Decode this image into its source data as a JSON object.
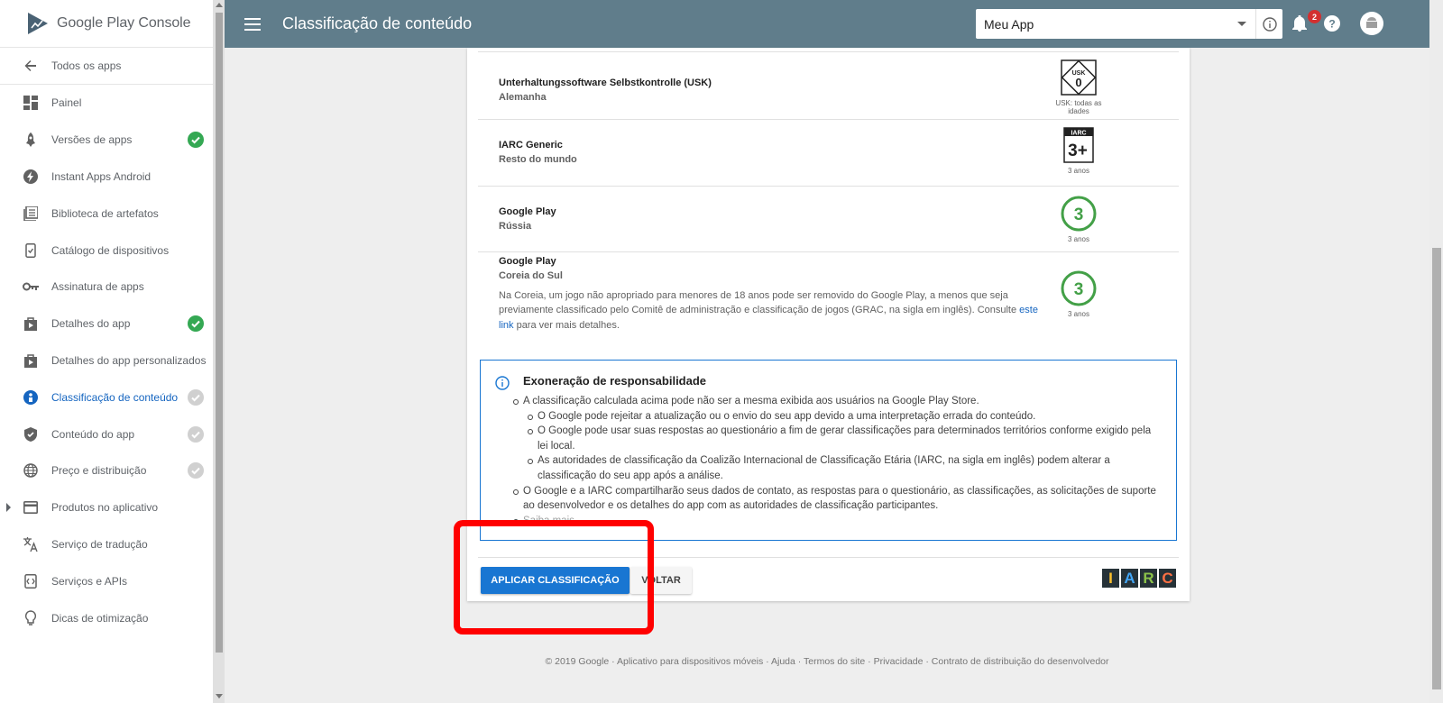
{
  "brand": {
    "name_part1": "Google Play ",
    "name_part2": "Console"
  },
  "sidebar": {
    "back_label": "Todos os apps",
    "items": [
      {
        "label": "Painel",
        "icon": "dashboard-icon",
        "status": "none"
      },
      {
        "label": "Versões de apps",
        "icon": "rocket-icon",
        "status": "done"
      },
      {
        "label": "Instant Apps Android",
        "icon": "bolt-icon",
        "status": "none"
      },
      {
        "label": "Biblioteca de artefatos",
        "icon": "library-icon",
        "status": "none"
      },
      {
        "label": "Catálogo de dispositivos",
        "icon": "device-catalog-icon",
        "status": "none"
      },
      {
        "label": "Assinatura de apps",
        "icon": "key-icon",
        "status": "none"
      },
      {
        "label": "Detalhes do app",
        "icon": "store-listing-icon",
        "status": "done"
      },
      {
        "label": "Detalhes do app personalizados",
        "icon": "custom-listing-icon",
        "status": "none"
      },
      {
        "label": "Classificação de conteúdo",
        "icon": "content-rating-icon",
        "status": "pending",
        "active": true
      },
      {
        "label": "Conteúdo do app",
        "icon": "shield-icon",
        "status": "pending"
      },
      {
        "label": "Preço e distribuição",
        "icon": "globe-icon",
        "status": "pending"
      },
      {
        "label": "Produtos no aplicativo",
        "icon": "card-icon",
        "status": "none",
        "expandable": true
      },
      {
        "label": "Serviço de tradução",
        "icon": "translate-icon",
        "status": "none"
      },
      {
        "label": "Serviços e APIs",
        "icon": "api-icon",
        "status": "none"
      },
      {
        "label": "Dicas de otimização",
        "icon": "lightbulb-icon",
        "status": "none"
      }
    ]
  },
  "header": {
    "title": "Classificação de conteúdo",
    "app_select_value": "Meu App",
    "notification_count": "2"
  },
  "ratings": [
    {
      "authority": "Unterhaltungssoftware Selbstkontrolle (USK)",
      "region": "Alemanha",
      "badge_text": "0",
      "badge_label": "USK",
      "caption": "USK: todas as idades"
    },
    {
      "authority": "IARC Generic",
      "region": "Resto do mundo",
      "badge_text": "3+",
      "badge_label": "IARC",
      "caption": "3 anos"
    },
    {
      "authority": "Google Play",
      "region": "Rússia",
      "badge_text": "3",
      "caption": "3 anos"
    },
    {
      "authority": "Google Play",
      "region": "Coreia do Sul",
      "badge_text": "3",
      "caption": "3 anos",
      "note_before": "Na Coreia, um jogo não apropriado para menores de 18 anos pode ser removido do Google Play, a menos que seja previamente classificado pelo Comitê de administração e classificação de jogos (GRAC, na sigla em inglês). Consulte ",
      "note_link": "este link",
      "note_after": " para ver mais detalhes."
    }
  ],
  "disclaimer": {
    "title": "Exoneração de responsabilidade",
    "item1": "A classificação calculada acima pode não ser a mesma exibida aos usuários na Google Play Store.",
    "sub1": "O Google pode rejeitar a atualização ou o envio do seu app devido a uma interpretação errada do conteúdo.",
    "sub2": "O Google pode usar suas respostas ao questionário a fim de gerar classificações para determinados territórios conforme exigido pela lei local.",
    "sub3": "As autoridades de classificação da Coalizão Internacional de Classificação Etária (IARC, na sigla em inglês) podem alterar a classificação do seu app após a análise.",
    "item2": "O Google e a IARC compartilharão seus dados de contato, as respostas para o questionário, as classificações, as solicitações de suporte ao desenvolvedor e os detalhes do app com as autoridades de classificação participantes.",
    "item3_partial": "Saiba mais"
  },
  "actions": {
    "apply_label": "APLICAR CLASSIFICAÇÃO",
    "back_label": "VOLTAR"
  },
  "iarc_logo": {
    "letters": [
      "I",
      "A",
      "R",
      "C"
    ],
    "colors": [
      "#fbc02d",
      "#42a5f5",
      "#8bc34a",
      "#ff7043"
    ]
  },
  "footer": {
    "text": "© 2019 Google · Aplicativo para dispositivos móveis · Ajuda · Termos do site · Privacidade · Contrato de distribuição do desenvolvedor"
  },
  "colors": {
    "header_bg": "#607d8b",
    "accent": "#1976d2",
    "rating_green": "#43a047",
    "highlight": "#ff0000"
  }
}
